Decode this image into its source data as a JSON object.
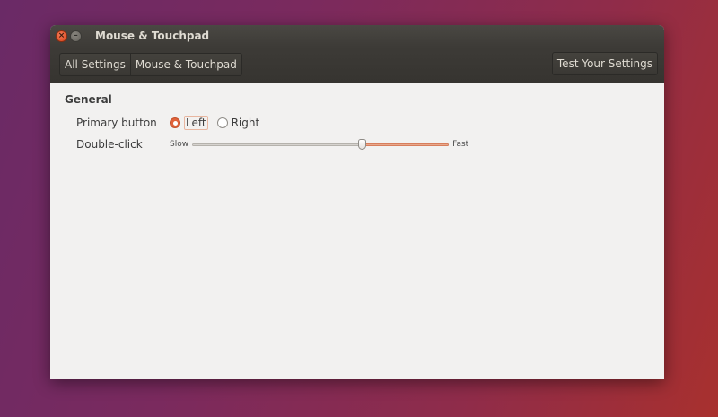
{
  "window": {
    "title": "Mouse & Touchpad",
    "close_glyph": "×",
    "min_glyph": "–"
  },
  "toolbar": {
    "all_settings": "All Settings",
    "current": "Mouse & Touchpad",
    "test_settings": "Test Your Settings"
  },
  "general": {
    "title": "General",
    "primary_button": {
      "label": "Primary button",
      "options": [
        "Left",
        "Right"
      ],
      "selected": "Left"
    },
    "double_click": {
      "label": "Double-click",
      "min_label": "Slow",
      "max_label": "Fast",
      "value": 0.66
    }
  },
  "colors": {
    "accent": "#e0623a",
    "titlebar": "#3d3b37",
    "window_bg": "#f2f1f0"
  }
}
